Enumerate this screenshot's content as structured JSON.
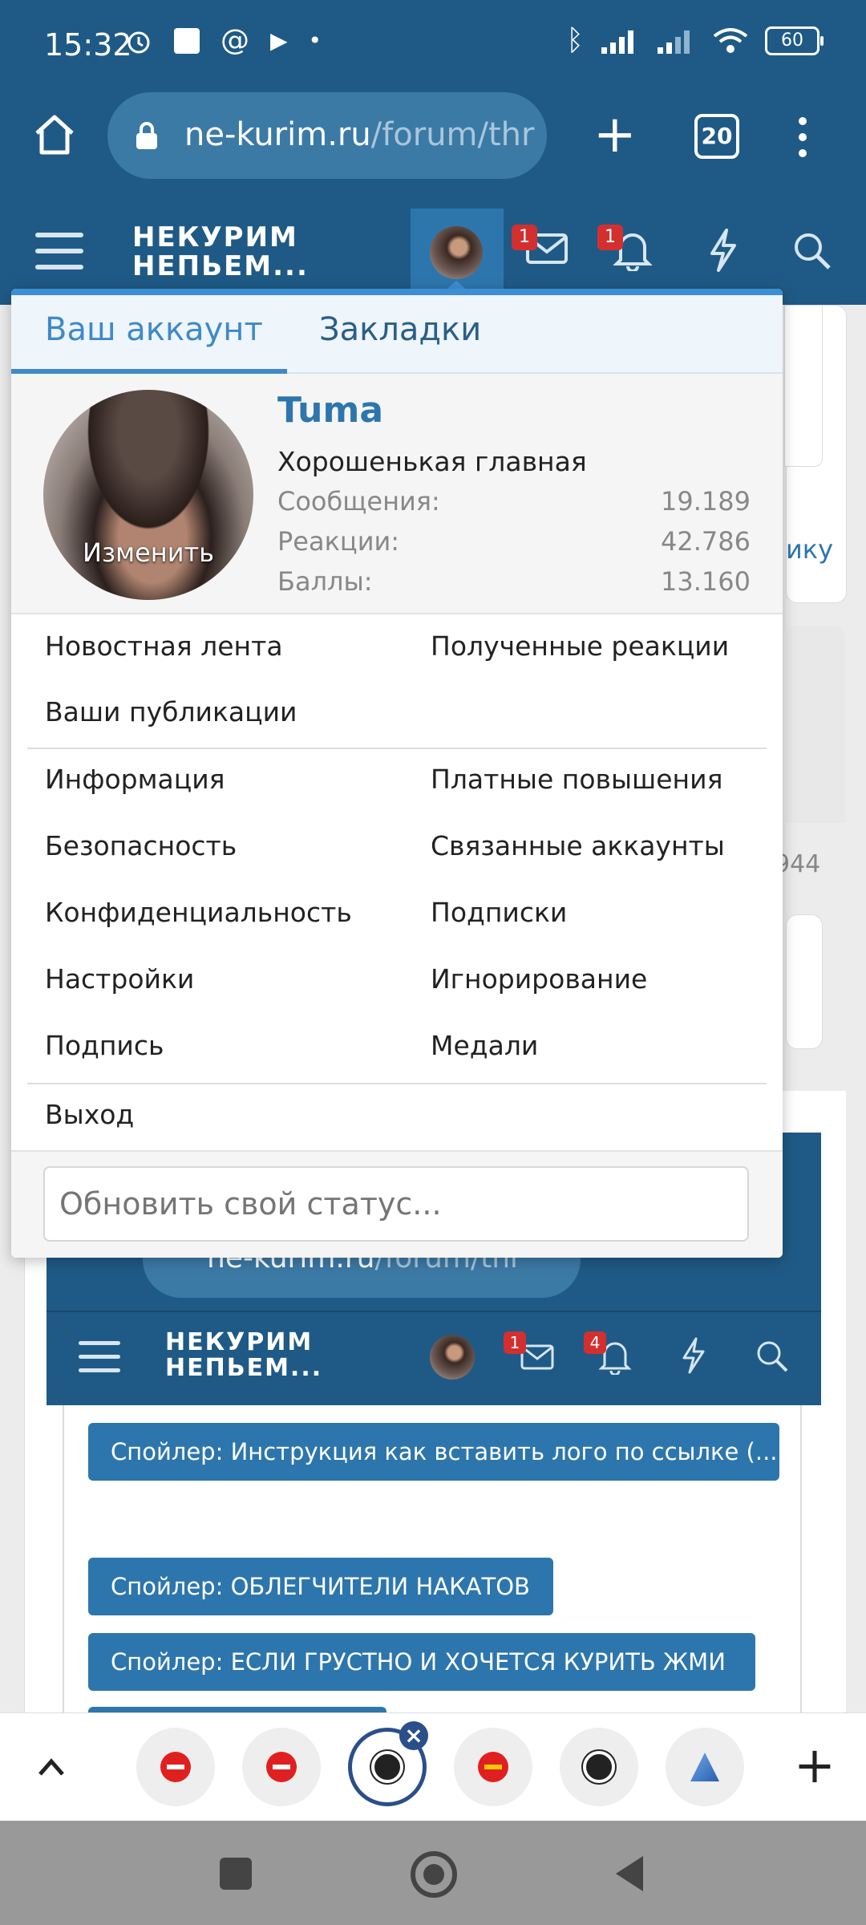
{
  "status_bar": {
    "time": "15:32",
    "battery": "60"
  },
  "browser": {
    "url_host": "ne-kurim.ru",
    "url_path": "/forum/thr",
    "tab_count": "20"
  },
  "forum_header": {
    "logo_line1": "НЕКУРИМ",
    "logo_line2": "НЕПЬЕМ...",
    "messages_badge": "1",
    "alerts_badge": "1"
  },
  "background_page": {
    "link_fragment": "ику",
    "count_fragment": "944"
  },
  "account_menu": {
    "tabs": [
      "Ваш аккаунт",
      "Закладки"
    ],
    "avatar_change_label": "Изменить",
    "username": "Tuma",
    "user_title": "Хорошенькая главная",
    "stats": [
      {
        "label": "Сообщения:",
        "value": "19.189"
      },
      {
        "label": "Реакции:",
        "value": "42.786"
      },
      {
        "label": "Баллы:",
        "value": "13.160"
      }
    ],
    "menu_group1": {
      "left": [
        "Новостная лента",
        "Ваши публикации"
      ],
      "right": [
        "Полученные реакции"
      ]
    },
    "menu_group2": {
      "left": [
        "Информация",
        "Безопасность",
        "Конфиденциальность",
        "Настройки",
        "Подпись"
      ],
      "right": [
        "Платные повышения",
        "Связанные аккаунты",
        "Подписки",
        "Игнорирование",
        "Медали"
      ]
    },
    "logout_label": "Выход",
    "status_placeholder": "Обновить свой статус..."
  },
  "embedded_screenshot": {
    "url_host": "ne-kurim.ru",
    "url_path": "/forum/thr",
    "logo_line1": "НЕКУРИМ",
    "logo_line2": "НЕПЬЕМ...",
    "messages_badge": "1",
    "alerts_badge": "4",
    "spoilers": [
      "Спойлер: Инструкция как вставить лого по ссылке (...",
      "Спойлер: ОБЛЕГЧИТЕЛИ НАКАТОВ",
      "Спойлер: ЕСЛИ ГРУСТНО И ХОЧЕТСЯ КУРИТЬ ЖМИ"
    ]
  },
  "colors": {
    "header": "#1f5a86",
    "accent": "#2d76ad",
    "badge": "#d32f2f"
  }
}
